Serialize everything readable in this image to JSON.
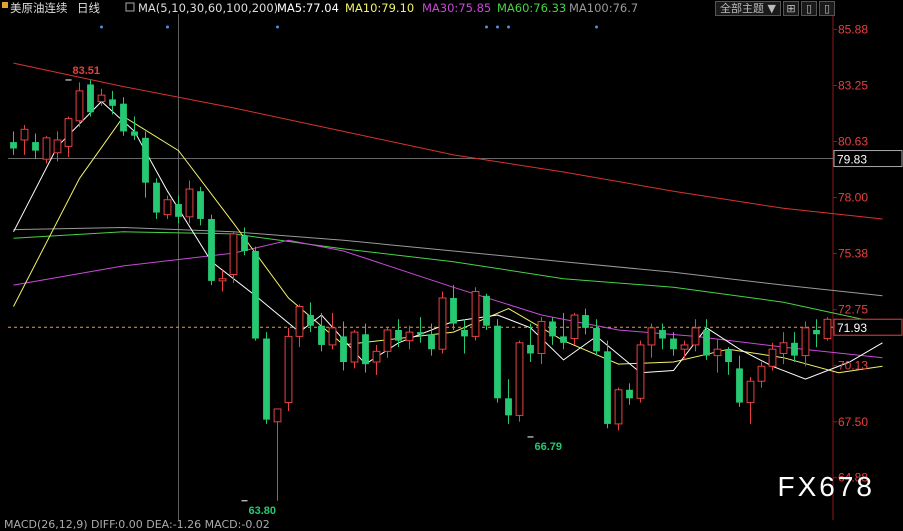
{
  "header": {
    "title": "美原油连续",
    "period": "日线",
    "ma_params": "MA(5,10,30,60,100,200)",
    "ma5": "MA5:77.04",
    "ma10": "MA10:79.10",
    "ma30": "MA30:75.85",
    "ma60": "MA60:76.33",
    "ma100": "MA100:76.7"
  },
  "toolbar": {
    "theme_select": "全部主题",
    "icon_a": "⊞",
    "icon_b": "▯",
    "icon_c": "▯"
  },
  "colors": {
    "up": "#e84040",
    "down": "#26c872",
    "ma5": "#ffffff",
    "ma10": "#f2f26a",
    "ma30": "#c84ad8",
    "ma60": "#46d446",
    "ma100": "#9a9a9a",
    "ma200": "#d8332e",
    "axis": "#e84040",
    "dash": "#e8a030"
  },
  "watermark": "FX678",
  "macd_text": "MACD(26,12,9) DIFF:0.00  DEA:-1.26  MACD:-0.02",
  "current_price": "71.93",
  "crosshair_price": "79.83",
  "chart_data": {
    "type": "candlestick",
    "y_ticks": [
      85.88,
      83.25,
      80.63,
      78.0,
      75.38,
      72.75,
      70.13,
      67.5,
      64.88
    ],
    "ylim": [
      62.9,
      86.6
    ],
    "crosshair": {
      "index": 15,
      "price": 79.83
    },
    "current": 71.93,
    "annotations": [
      {
        "text": "83.51",
        "index": 5,
        "price": 83.51,
        "color": "#e84040"
      },
      {
        "text": "63.80",
        "index": 21,
        "price": 63.8,
        "color": "#26c872"
      },
      {
        "text": "66.79",
        "index": 47,
        "price": 66.79,
        "color": "#26c872"
      }
    ],
    "candles": [
      [
        80.6,
        81.1,
        80.0,
        80.3
      ],
      [
        80.7,
        81.4,
        80.0,
        81.2
      ],
      [
        80.6,
        81.0,
        79.8,
        80.2
      ],
      [
        79.8,
        80.9,
        79.6,
        80.8
      ],
      [
        80.1,
        81.1,
        79.7,
        80.7
      ],
      [
        80.4,
        81.8,
        79.9,
        81.7
      ],
      [
        81.6,
        83.4,
        81.3,
        83.0
      ],
      [
        83.3,
        83.5,
        81.8,
        82.0
      ],
      [
        82.5,
        83.1,
        82.3,
        82.8
      ],
      [
        82.6,
        83.0,
        81.9,
        82.3
      ],
      [
        82.4,
        82.7,
        80.9,
        81.1
      ],
      [
        81.1,
        81.8,
        80.7,
        80.9
      ],
      [
        80.8,
        81.1,
        78.0,
        78.7
      ],
      [
        78.7,
        78.9,
        77.0,
        77.3
      ],
      [
        77.2,
        78.1,
        77.0,
        77.9
      ],
      [
        77.7,
        78.1,
        76.8,
        77.1
      ],
      [
        77.1,
        78.8,
        76.8,
        78.4
      ],
      [
        78.3,
        78.5,
        76.7,
        77.0
      ],
      [
        77.0,
        77.2,
        73.9,
        74.1
      ],
      [
        74.1,
        74.6,
        73.6,
        74.2
      ],
      [
        74.4,
        76.4,
        74.0,
        76.3
      ],
      [
        76.2,
        76.6,
        75.3,
        75.5
      ],
      [
        75.5,
        75.7,
        71.3,
        71.4
      ],
      [
        71.4,
        71.7,
        67.4,
        67.6
      ],
      [
        67.5,
        68.0,
        63.8,
        68.1
      ],
      [
        68.4,
        71.9,
        68.0,
        71.5
      ],
      [
        71.5,
        73.0,
        71.0,
        72.9
      ],
      [
        72.5,
        73.1,
        71.7,
        72.0
      ],
      [
        72.0,
        72.6,
        70.8,
        71.1
      ],
      [
        71.1,
        72.6,
        70.9,
        71.9
      ],
      [
        71.5,
        72.2,
        69.9,
        70.3
      ],
      [
        70.3,
        71.8,
        70.0,
        71.7
      ],
      [
        71.6,
        72.1,
        69.8,
        70.2
      ],
      [
        70.3,
        71.1,
        69.7,
        70.8
      ],
      [
        70.8,
        71.9,
        70.5,
        71.8
      ],
      [
        71.8,
        72.3,
        71.0,
        71.3
      ],
      [
        71.3,
        72.0,
        70.9,
        71.7
      ],
      [
        71.7,
        72.4,
        71.2,
        71.6
      ],
      [
        71.6,
        72.1,
        70.6,
        70.9
      ],
      [
        70.9,
        73.6,
        70.7,
        73.3
      ],
      [
        73.3,
        73.9,
        71.8,
        72.1
      ],
      [
        71.8,
        72.3,
        70.7,
        71.5
      ],
      [
        71.5,
        73.8,
        71.3,
        73.6
      ],
      [
        73.4,
        73.5,
        71.8,
        72.0
      ],
      [
        72.0,
        72.3,
        68.4,
        68.6
      ],
      [
        68.6,
        69.5,
        67.4,
        67.8
      ],
      [
        67.8,
        71.3,
        67.5,
        71.2
      ],
      [
        71.1,
        72.1,
        70.3,
        70.7
      ],
      [
        70.7,
        72.4,
        70.2,
        72.2
      ],
      [
        72.2,
        72.4,
        71.1,
        71.5
      ],
      [
        71.5,
        72.6,
        70.9,
        71.2
      ],
      [
        71.4,
        72.6,
        71.1,
        72.5
      ],
      [
        72.5,
        72.8,
        71.6,
        71.9
      ],
      [
        71.9,
        72.3,
        70.6,
        70.8
      ],
      [
        70.8,
        71.3,
        67.2,
        67.4
      ],
      [
        67.4,
        69.1,
        67.1,
        69.0
      ],
      [
        69.0,
        69.3,
        68.3,
        68.6
      ],
      [
        68.6,
        71.3,
        68.4,
        71.1
      ],
      [
        71.1,
        72.1,
        70.5,
        71.9
      ],
      [
        71.8,
        72.1,
        70.9,
        71.4
      ],
      [
        71.4,
        71.7,
        70.6,
        70.9
      ],
      [
        70.9,
        71.3,
        70.4,
        71.1
      ],
      [
        71.1,
        72.3,
        70.8,
        71.9
      ],
      [
        71.8,
        72.3,
        70.4,
        70.6
      ],
      [
        70.6,
        71.4,
        69.8,
        70.9
      ],
      [
        70.9,
        71.0,
        69.7,
        70.3
      ],
      [
        70.0,
        70.6,
        68.2,
        68.4
      ],
      [
        68.4,
        69.6,
        67.4,
        69.4
      ],
      [
        69.4,
        70.3,
        69.1,
        70.1
      ],
      [
        70.1,
        71.2,
        69.9,
        70.9
      ],
      [
        70.7,
        71.7,
        70.2,
        71.2
      ],
      [
        71.2,
        71.7,
        70.3,
        70.6
      ],
      [
        70.6,
        72.2,
        70.1,
        71.9
      ],
      [
        71.8,
        72.3,
        71.0,
        71.6
      ],
      [
        71.4,
        72.4,
        71.3,
        72.3
      ]
    ],
    "ma200": [
      [
        0,
        84.3
      ],
      [
        10,
        83.2
      ],
      [
        20,
        82.2
      ],
      [
        30,
        81.1
      ],
      [
        40,
        80.0
      ],
      [
        50,
        79.2
      ],
      [
        60,
        78.3
      ],
      [
        70,
        77.5
      ],
      [
        79,
        77.0
      ]
    ],
    "ma100": [
      [
        0,
        76.5
      ],
      [
        10,
        76.6
      ],
      [
        20,
        76.4
      ],
      [
        30,
        76.0
      ],
      [
        40,
        75.5
      ],
      [
        50,
        75.0
      ],
      [
        60,
        74.5
      ],
      [
        70,
        73.9
      ],
      [
        79,
        73.4
      ]
    ],
    "ma60": [
      [
        0,
        76.1
      ],
      [
        10,
        76.4
      ],
      [
        20,
        76.3
      ],
      [
        30,
        75.6
      ],
      [
        40,
        75.0
      ],
      [
        50,
        74.2
      ],
      [
        60,
        73.8
      ],
      [
        70,
        73.1
      ],
      [
        79,
        72.1
      ]
    ],
    "ma30": [
      [
        0,
        73.9
      ],
      [
        10,
        74.8
      ],
      [
        20,
        75.4
      ],
      [
        25,
        76.0
      ],
      [
        30,
        75.5
      ],
      [
        40,
        73.8
      ],
      [
        48,
        72.5
      ],
      [
        55,
        71.8
      ],
      [
        62,
        71.5
      ],
      [
        70,
        71.0
      ],
      [
        79,
        70.5
      ]
    ],
    "ma10": [
      [
        0,
        72.9
      ],
      [
        6,
        78.9
      ],
      [
        10,
        81.8
      ],
      [
        15,
        80.2
      ],
      [
        20,
        76.8
      ],
      [
        25,
        73.3
      ],
      [
        30,
        71.1
      ],
      [
        35,
        71.4
      ],
      [
        40,
        71.7
      ],
      [
        45,
        72.8
      ],
      [
        50,
        71.3
      ],
      [
        55,
        70.2
      ],
      [
        60,
        70.3
      ],
      [
        65,
        70.9
      ],
      [
        70,
        70.5
      ],
      [
        75,
        69.8
      ],
      [
        79,
        70.1
      ]
    ],
    "ma5": [
      [
        0,
        76.4
      ],
      [
        4,
        80.4
      ],
      [
        8,
        82.5
      ],
      [
        11,
        81.1
      ],
      [
        14,
        78.3
      ],
      [
        18,
        75.0
      ],
      [
        22,
        73.4
      ],
      [
        26,
        71.7
      ],
      [
        28,
        72.5
      ],
      [
        32,
        70.2
      ],
      [
        35,
        71.2
      ],
      [
        40,
        72.2
      ],
      [
        44,
        72.5
      ],
      [
        47,
        71.9
      ],
      [
        50,
        70.4
      ],
      [
        53,
        71.5
      ],
      [
        57,
        69.8
      ],
      [
        60,
        69.9
      ],
      [
        63,
        71.9
      ],
      [
        66,
        70.9
      ],
      [
        69,
        70.1
      ],
      [
        72,
        69.5
      ],
      [
        76,
        70.3
      ],
      [
        79,
        71.2
      ]
    ]
  }
}
